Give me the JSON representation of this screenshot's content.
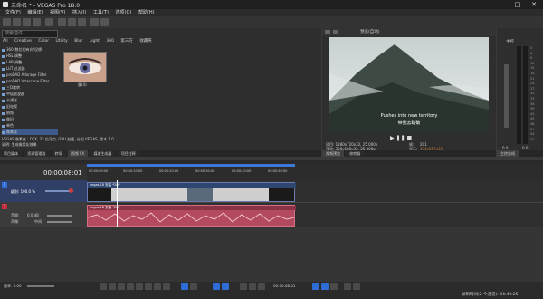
{
  "app": {
    "title": "未命名 * - VEGAS Pro 18.0"
  },
  "window": {
    "min": "—",
    "max": "□",
    "close": "✕"
  },
  "menu": [
    "文件(F)",
    "编辑(E)",
    "视图(V)",
    "插入(I)",
    "工具(T)",
    "选项(O)",
    "帮助(H)"
  ],
  "fx": {
    "search_placeholder": "搜索插件",
    "categories": [
      "All",
      "Creative",
      "Color",
      "Utility",
      "Blur",
      "Light",
      "360",
      "第三方",
      "收藏夹"
    ],
    "items": [
      "360°数位的有向/设想",
      "HSL 调整",
      "LAB 调整",
      "LUT 过滤器",
      "proDAD Adorage Filter",
      "proDAD Vitascene Filter",
      "三D旋转",
      "中值滤波器",
      "卡通化",
      "旧电视",
      "倒角",
      "做旧",
      "单色",
      "像素化"
    ],
    "preset_label": "膜(4)",
    "info1": "VEGAS 像素化 : OFX, 32 位浮点, GPU 加速, 分组 VEGAS, 版本 1.0",
    "info2": "说明: 生成像素化效果"
  },
  "left_tabs": [
    "项目媒体",
    "资源管理器",
    "转场",
    "视频 FX",
    "媒体生成器",
    "项目注释"
  ],
  "preview": {
    "menu_label": "预览(自动)",
    "subtitle1": "Pushes into new territory",
    "subtitle2": "带我去踏破",
    "info_project": "项目: 1280x720x32, 25.000p",
    "info_preview": "预览: 320x180x32, 25.000p",
    "info_frame": "帧:",
    "frame_value": "201",
    "info_display": "显示:",
    "display_value": "474x267x32",
    "tabs": [
      "视频预览",
      "修剪器"
    ]
  },
  "master": {
    "label": "主控",
    "scale": [
      "3",
      "6",
      "9",
      "12",
      "15",
      "18",
      "21",
      "24",
      "27",
      "30",
      "33",
      "36",
      "39",
      "42",
      "45",
      "48",
      "51",
      "54",
      "57"
    ],
    "bus_tab": "主控总线",
    "bottom": [
      "0.0",
      "0.0"
    ]
  },
  "timeline": {
    "time": "00:00:08:01",
    "ruler": [
      "00:00:00:00",
      "00:00:10:00",
      "00:00:20:00",
      "00:00:30:00",
      "00:00:40:00",
      "00:00:50:00"
    ],
    "video_track": {
      "number": "1",
      "level_label": "级别: 100.0 %",
      "clip_name": "vegas 18 安装 *20P"
    },
    "audio_track": {
      "number": "2",
      "vol_label": "音量:",
      "vol_value": "0.0 dB",
      "pan_label": "声像:",
      "pan_value": "中间",
      "clip_name": "vegas 18 安装 *20P"
    }
  },
  "transport": {
    "rate_label": "速率: 0.00",
    "time": "00:00:08:01"
  },
  "status": {
    "text": "录制时间(2 个通道): 04:40:25"
  }
}
